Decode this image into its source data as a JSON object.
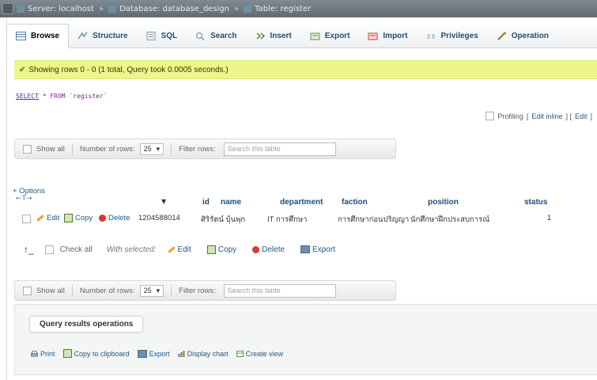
{
  "breadcrumb": {
    "items": [
      {
        "label": "Server: localhost",
        "icon": "server-icon"
      },
      {
        "label": "Database: database_design",
        "icon": "database-icon"
      },
      {
        "label": "Table: register",
        "icon": "table-icon"
      }
    ]
  },
  "tabs": [
    {
      "label": "Browse",
      "icon": "browse-icon",
      "active": true
    },
    {
      "label": "Structure",
      "icon": "structure-icon"
    },
    {
      "label": "SQL",
      "icon": "sql-icon"
    },
    {
      "label": "Search",
      "icon": "search-icon"
    },
    {
      "label": "Insert",
      "icon": "insert-icon"
    },
    {
      "label": "Export",
      "icon": "export-icon"
    },
    {
      "label": "Import",
      "icon": "import-icon"
    },
    {
      "label": "Privileges",
      "icon": "privileges-icon"
    },
    {
      "label": "Operation",
      "icon": "operations-icon"
    }
  ],
  "message": "Showing rows 0 - 0 (1 total, Query took 0.0005 seconds.)",
  "query": {
    "select": "SELECT",
    "rest": " * FROM `register`"
  },
  "profiling": {
    "label": "Profiling",
    "edit_inline": "Edit inline",
    "edit": "Edit"
  },
  "nav": {
    "show_all": "Show all",
    "rows_label": "Number of rows:",
    "rows_value": "25",
    "filter_label": "Filter rows:",
    "filter_placeholder": "Search this table"
  },
  "options_label": "+ Options",
  "columns": [
    "id",
    "name",
    "department",
    "faction",
    "position",
    "status"
  ],
  "row": {
    "edit": "Edit",
    "copy": "Copy",
    "delete": "Delete",
    "id": "1204588014",
    "name": "ศิริรัตน์ บุ้นพุก",
    "department": "IT การศึกษา",
    "faction": "การศึกษาก่อนปริญญา",
    "position": "นักศึกษาฝึกประสบการณ์",
    "status": "1"
  },
  "bulk": {
    "check_all": "Check all",
    "with_selected": "With selected:",
    "edit": "Edit",
    "copy": "Copy",
    "delete": "Delete",
    "export": "Export"
  },
  "qro": {
    "title": "Query results operations",
    "print": "Print",
    "copy": "Copy to clipboard",
    "export": "Export",
    "chart": "Display chart",
    "view": "Create view"
  },
  "colors": {
    "success_bg": "#eef58a",
    "link": "#235a81",
    "delete": "#d53b2c"
  }
}
